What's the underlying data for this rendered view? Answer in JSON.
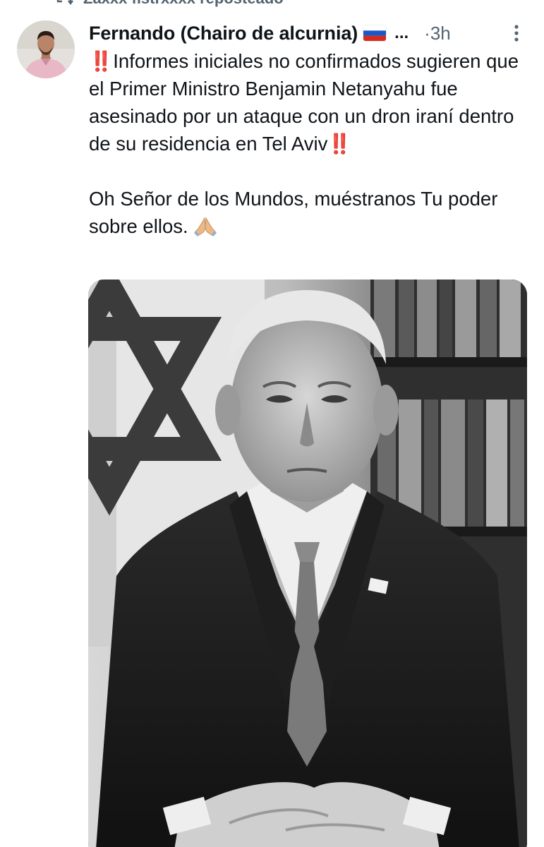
{
  "repost_banner": {
    "text": "Zaxxx fistrxxxx reposteado",
    "icon": "repost-icon"
  },
  "tweet": {
    "author": {
      "display_name": "Fernando (Chairo de alcurnia)",
      "flag_icon": "russia-flag-icon",
      "name_overflow": "...",
      "avatar_icon": "avatar"
    },
    "time": "3h",
    "time_separator": "·",
    "more_icon": "more-vertical-icon",
    "text": {
      "bang_prefix": "‼️",
      "line_1": "Informes iniciales no confirmados sugieren que el Primer Ministro Benjamin Netanyahu fue asesinado por un ataque con un dron iraní dentro de su residencia en Tel Aviv",
      "bang_suffix": "‼️",
      "line_2": "Oh Señor de los Mundos, muéstranos Tu poder sobre ellos.",
      "pray_icon": "folded-hands-icon"
    },
    "media": {
      "type": "photo",
      "description_icon": "photo-image"
    }
  },
  "colors": {
    "text_primary": "#0f1419",
    "text_secondary": "#536471",
    "alert_red": "#e0192f",
    "background": "#ffffff"
  }
}
